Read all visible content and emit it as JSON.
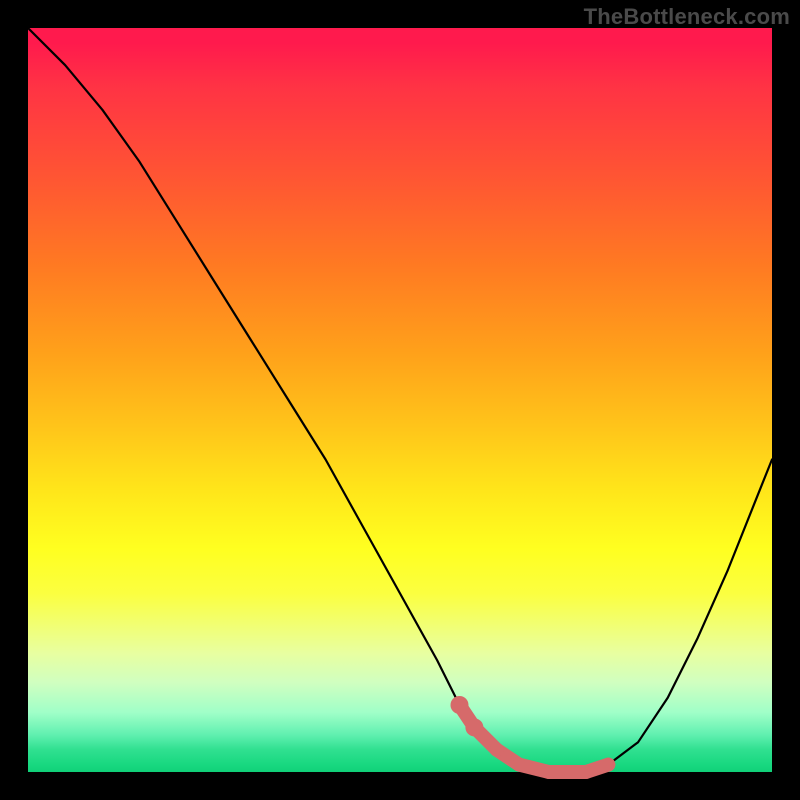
{
  "watermark": "TheBottleneck.com",
  "chart_data": {
    "type": "line",
    "title": "",
    "xlabel": "",
    "ylabel": "",
    "xlim": [
      0,
      100
    ],
    "ylim": [
      0,
      100
    ],
    "background": "red-yellow-green vertical gradient (bottleneck severity)",
    "series": [
      {
        "name": "bottleneck-curve",
        "color": "#000000",
        "x": [
          0,
          5,
          10,
          15,
          20,
          25,
          30,
          35,
          40,
          45,
          50,
          55,
          58,
          60,
          63,
          66,
          70,
          73,
          75,
          78,
          82,
          86,
          90,
          94,
          98,
          100
        ],
        "y": [
          100,
          95,
          89,
          82,
          74,
          66,
          58,
          50,
          42,
          33,
          24,
          15,
          9,
          6,
          3,
          1,
          0,
          0,
          0,
          1,
          4,
          10,
          18,
          27,
          37,
          42
        ]
      },
      {
        "name": "optimal-band-markers",
        "color": "#d66a6a",
        "type": "scatter",
        "x": [
          58,
          60,
          63,
          66,
          70,
          73,
          75,
          78
        ],
        "y": [
          9,
          6,
          3,
          1,
          0,
          0,
          0,
          1
        ]
      }
    ],
    "annotations": []
  }
}
